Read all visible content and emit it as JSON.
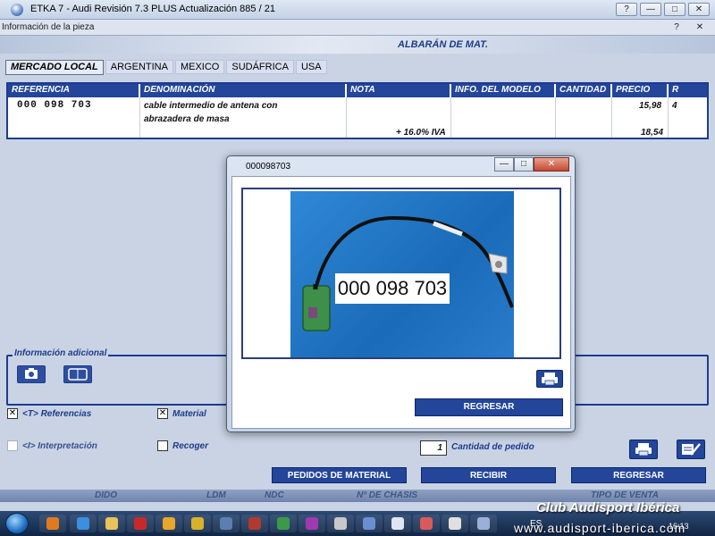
{
  "window": {
    "title": "ETKA 7 - Audi Revisión 7.3 PLUS Actualización 885 / 21",
    "help_glyph": "?",
    "minimize_glyph": "—",
    "maximize_glyph": "□",
    "close_glyph": "✕"
  },
  "child_window": {
    "title": "Información de la pieza",
    "help_glyph": "?",
    "close_glyph": "✕"
  },
  "banner": {
    "label": "ALBARÁN DE MAT."
  },
  "tabs": [
    {
      "label": "MERCADO LOCAL",
      "active": true
    },
    {
      "label": "ARGENTINA",
      "active": false
    },
    {
      "label": "MEXICO",
      "active": false
    },
    {
      "label": "SUDÁFRICA",
      "active": false
    },
    {
      "label": "USA",
      "active": false
    }
  ],
  "table": {
    "headers": {
      "referencia": "REFERENCIA",
      "denominacion": "DENOMINACIÓN",
      "nota": "NOTA",
      "info_modelo": "INFO. DEL MODELO",
      "cantidad": "CANTIDAD",
      "precio": "PRECIO",
      "r": "R"
    },
    "row": {
      "referencia": "000 098 703",
      "denominacion_line1": "cable intermedio de antena con",
      "denominacion_line2": "abrazadera de masa",
      "precio": "15,98",
      "r": "4",
      "iva_label": "+ 16.0% IVA",
      "precio_iva": "18,54"
    }
  },
  "info_adicional": {
    "legend": "Información adicional"
  },
  "checkboxes": {
    "referencias": {
      "label": "<T> Referencias",
      "mark": "✕"
    },
    "material": {
      "label": "Material",
      "mark": "✕"
    },
    "interpretacion": {
      "label": "<I> Interpretación",
      "mark": ""
    },
    "recoger": {
      "label": "Recoger",
      "mark": ""
    }
  },
  "quantity": {
    "value": "1",
    "label": "Cantidad de pedido"
  },
  "buttons": {
    "pedidos": "PEDIDOS DE MATERIAL",
    "recibir": "RECIBIR",
    "regresar": "REGRESAR"
  },
  "footer_strip": {
    "col1": "DIDO",
    "col2": "LDM",
    "col3": "NDC",
    "col4": "Nº DE CHASIS",
    "col5": "TIPO DE VENTA"
  },
  "dialog": {
    "title": "000098703",
    "photo_label": "000 098 703",
    "regresar_label": "REGRESAR",
    "minimize_glyph": "—",
    "maximize_glyph": "□",
    "close_glyph": "✕"
  },
  "taskbar": {
    "language": "ES",
    "clock": "16:13"
  },
  "watermark": {
    "line1": "Club Audisport Ibérica",
    "line2": "www.audisport-iberica.com"
  },
  "colors": {
    "accent": "#23459a",
    "banner_text": "#1d3b8a",
    "connector_green": "#3d8f4a"
  }
}
